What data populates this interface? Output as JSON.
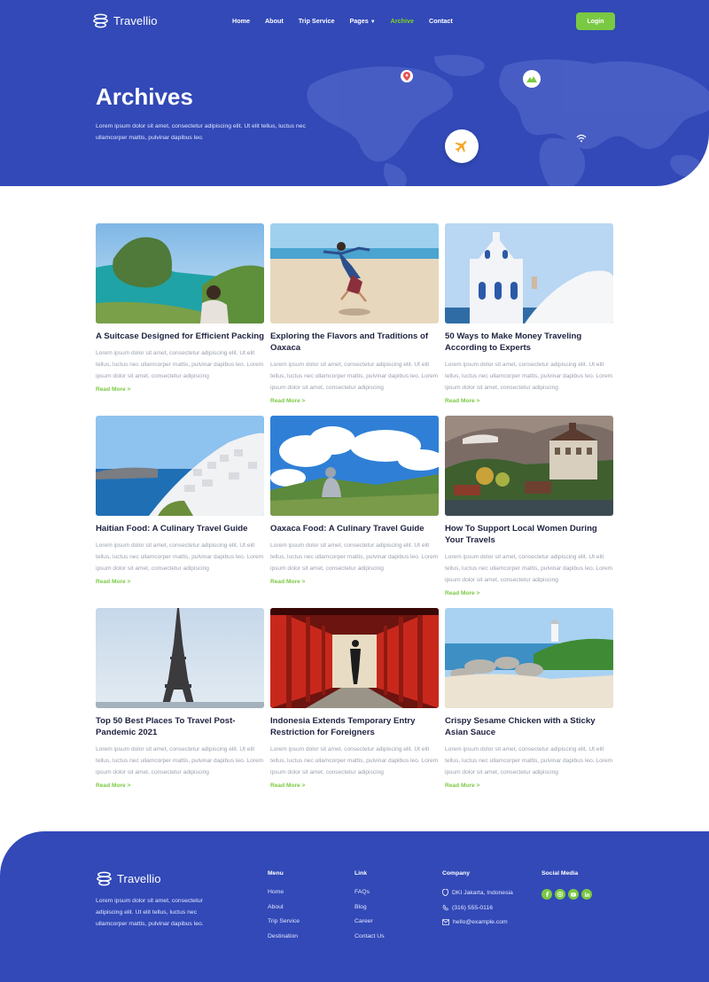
{
  "brand": {
    "name": "Travellio"
  },
  "colors": {
    "primary": "#3249b7",
    "accent": "#7ac943"
  },
  "nav": {
    "items": [
      {
        "label": "Home",
        "active": false
      },
      {
        "label": "About",
        "active": false
      },
      {
        "label": "Trip Service",
        "active": false
      },
      {
        "label": "Pages",
        "active": false,
        "dropdown": true
      },
      {
        "label": "Archive",
        "active": true
      },
      {
        "label": "Contact",
        "active": false
      }
    ],
    "login_label": "Login"
  },
  "hero": {
    "title": "Archives",
    "subtitle": "Lorem ipsum dolor sit amet, consectetur adipiscing elit. Ut elit tellus, luctus nec ullamcorper mattis, pulvinar dapibus leo.",
    "icons": [
      "location-pin-icon",
      "mountain-icon",
      "airplane-icon",
      "wifi-icon"
    ]
  },
  "posts": [
    {
      "title": "A Suitcase Designed for Efficient Packing",
      "excerpt": "Lorem ipsum dolor sit amet, consectetur adipiscing elit. Ut elit tellus, luctus nec ullamcorper mattis, pulvinar dapibus leo. Lorem ipsum dolor sit amet, consectetur adipiscing",
      "read_more": "Read More >"
    },
    {
      "title": "Exploring the Flavors and Traditions of Oaxaca",
      "excerpt": "Lorem ipsum dolor sit amet, consectetur adipiscing elit. Ut elit tellus, luctus nec ullamcorper mattis, pulvinar dapibus leo. Lorem ipsum dolor sit amet, consectetur adipiscing",
      "read_more": "Read More >"
    },
    {
      "title": "50 Ways to Make Money Traveling According to Experts",
      "excerpt": "Lorem ipsum dolor sit amet, consectetur adipiscing elit. Ut elit tellus, luctus nec ullamcorper mattis, pulvinar dapibus leo. Lorem ipsum dolor sit amet, consectetur adipiscing",
      "read_more": "Read More >"
    },
    {
      "title": "Haitian Food: A Culinary Travel Guide",
      "excerpt": "Lorem ipsum dolor sit amet, consectetur adipiscing elit. Ut elit tellus, luctus nec ullamcorper mattis, pulvinar dapibus leo. Lorem ipsum dolor sit amet, consectetur adipiscing",
      "read_more": "Read More >"
    },
    {
      "title": "Oaxaca Food: A Culinary Travel Guide",
      "excerpt": "Lorem ipsum dolor sit amet, consectetur adipiscing elit. Ut elit tellus, luctus nec ullamcorper mattis, pulvinar dapibus leo. Lorem ipsum dolor sit amet, consectetur adipiscing",
      "read_more": "Read More >"
    },
    {
      "title": "How To Support Local Women During Your Travels",
      "excerpt": "Lorem ipsum dolor sit amet, consectetur adipiscing elit. Ut elit tellus, luctus nec ullamcorper mattis, pulvinar dapibus leo. Lorem ipsum dolor sit amet, consectetur adipiscing",
      "read_more": "Read More >"
    },
    {
      "title": "Top 50 Best Places To Travel Post-Pandemic 2021",
      "excerpt": "Lorem ipsum dolor sit amet, consectetur adipiscing elit. Ut elit tellus, luctus nec ullamcorper mattis, pulvinar dapibus leo. Lorem ipsum dolor sit amet, consectetur adipiscing",
      "read_more": "Read More >"
    },
    {
      "title": "Indonesia Extends Temporary Entry Restriction for Foreigners",
      "excerpt": "Lorem ipsum dolor sit amet, consectetur adipiscing elit. Ut elit tellus, luctus nec ullamcorper mattis, pulvinar dapibus leo. Lorem ipsum dolor sit amet, consectetur adipiscing",
      "read_more": "Read More >"
    },
    {
      "title": "Crispy Sesame Chicken with a Sticky Asian Sauce",
      "excerpt": "Lorem ipsum dolor sit amet, consectetur adipiscing elit. Ut elit tellus, luctus nec ullamcorper mattis, pulvinar dapibus leo. Lorem ipsum dolor sit amet, consectetur adipiscing",
      "read_more": "Read More >"
    }
  ],
  "footer": {
    "about": "Lorem ipsum dolor sit amet, consectetur adipiscing elit. Ut elit tellus, luctus nec ullamcorper mattis, pulvinar dapibus leo.",
    "menu": {
      "heading": "Menu",
      "links": [
        "Home",
        "About",
        "Trip Service",
        "Destination"
      ]
    },
    "link": {
      "heading": "Link",
      "links": [
        "FAQs",
        "Blog",
        "Career",
        "Contact Us"
      ]
    },
    "company": {
      "heading": "Company",
      "address": "DKI Jakarta, Indonesia",
      "phone": "(316) 555-0116",
      "email": "hello@example.com"
    },
    "social": {
      "heading": "Social Media",
      "icons": [
        "facebook-icon",
        "instagram-icon",
        "youtube-icon",
        "linkedin-icon"
      ]
    }
  }
}
